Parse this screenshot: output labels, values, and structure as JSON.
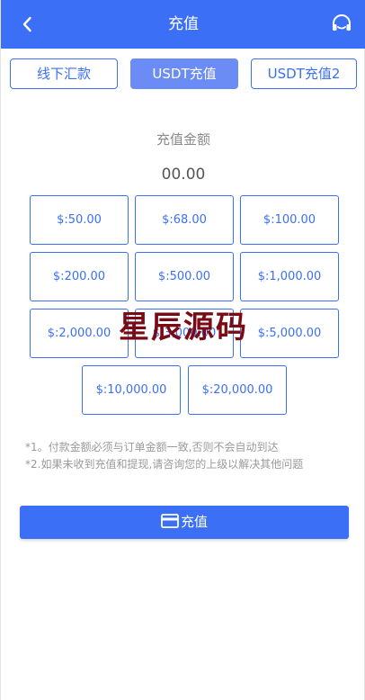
{
  "header": {
    "title": "充值",
    "back_icon": "chevron-left-icon",
    "support_icon": "headset-icon"
  },
  "tabs": [
    {
      "label": "线下汇款",
      "active": false
    },
    {
      "label": "USDT充值",
      "active": true
    },
    {
      "label": "USDT充值2",
      "active": false
    }
  ],
  "amount": {
    "label": "充值金额",
    "value": "00.00"
  },
  "presets": [
    "$:50.00",
    "$:68.00",
    "$:100.00",
    "$:200.00",
    "$:500.00",
    "$:1,000.00",
    "$:2,000.00",
    "$:3,000.00",
    "$:5,000.00",
    "$:10,000.00",
    "$:20,000.00"
  ],
  "watermark": "星辰源码",
  "notes": [
    "*1。付款金额必须与订单金额一致,否则不会自动到达",
    "*2.如果未收到充值和提现,请咨询您的上级以解决其他问题"
  ],
  "submit": {
    "label": "充值",
    "icon": "card-icon"
  },
  "colors": {
    "primary": "#3b6ff5",
    "tab_active": "#6b8cf4",
    "watermark": "#7a0a14"
  }
}
